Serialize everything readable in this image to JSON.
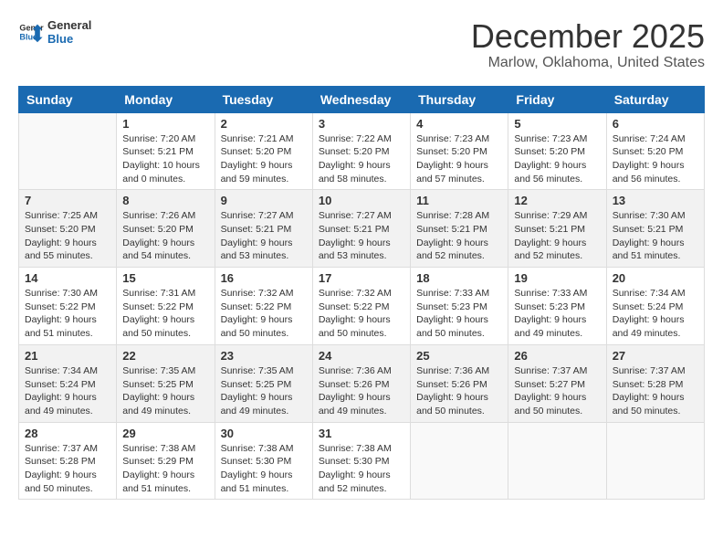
{
  "logo": {
    "line1": "General",
    "line2": "Blue"
  },
  "title": "December 2025",
  "subtitle": "Marlow, Oklahoma, United States",
  "weekdays": [
    "Sunday",
    "Monday",
    "Tuesday",
    "Wednesday",
    "Thursday",
    "Friday",
    "Saturday"
  ],
  "weeks": [
    [
      {
        "day": "",
        "detail": ""
      },
      {
        "day": "1",
        "detail": "Sunrise: 7:20 AM\nSunset: 5:21 PM\nDaylight: 10 hours\nand 0 minutes."
      },
      {
        "day": "2",
        "detail": "Sunrise: 7:21 AM\nSunset: 5:20 PM\nDaylight: 9 hours\nand 59 minutes."
      },
      {
        "day": "3",
        "detail": "Sunrise: 7:22 AM\nSunset: 5:20 PM\nDaylight: 9 hours\nand 58 minutes."
      },
      {
        "day": "4",
        "detail": "Sunrise: 7:23 AM\nSunset: 5:20 PM\nDaylight: 9 hours\nand 57 minutes."
      },
      {
        "day": "5",
        "detail": "Sunrise: 7:23 AM\nSunset: 5:20 PM\nDaylight: 9 hours\nand 56 minutes."
      },
      {
        "day": "6",
        "detail": "Sunrise: 7:24 AM\nSunset: 5:20 PM\nDaylight: 9 hours\nand 56 minutes."
      }
    ],
    [
      {
        "day": "7",
        "detail": "Sunrise: 7:25 AM\nSunset: 5:20 PM\nDaylight: 9 hours\nand 55 minutes."
      },
      {
        "day": "8",
        "detail": "Sunrise: 7:26 AM\nSunset: 5:20 PM\nDaylight: 9 hours\nand 54 minutes."
      },
      {
        "day": "9",
        "detail": "Sunrise: 7:27 AM\nSunset: 5:21 PM\nDaylight: 9 hours\nand 53 minutes."
      },
      {
        "day": "10",
        "detail": "Sunrise: 7:27 AM\nSunset: 5:21 PM\nDaylight: 9 hours\nand 53 minutes."
      },
      {
        "day": "11",
        "detail": "Sunrise: 7:28 AM\nSunset: 5:21 PM\nDaylight: 9 hours\nand 52 minutes."
      },
      {
        "day": "12",
        "detail": "Sunrise: 7:29 AM\nSunset: 5:21 PM\nDaylight: 9 hours\nand 52 minutes."
      },
      {
        "day": "13",
        "detail": "Sunrise: 7:30 AM\nSunset: 5:21 PM\nDaylight: 9 hours\nand 51 minutes."
      }
    ],
    [
      {
        "day": "14",
        "detail": "Sunrise: 7:30 AM\nSunset: 5:22 PM\nDaylight: 9 hours\nand 51 minutes."
      },
      {
        "day": "15",
        "detail": "Sunrise: 7:31 AM\nSunset: 5:22 PM\nDaylight: 9 hours\nand 50 minutes."
      },
      {
        "day": "16",
        "detail": "Sunrise: 7:32 AM\nSunset: 5:22 PM\nDaylight: 9 hours\nand 50 minutes."
      },
      {
        "day": "17",
        "detail": "Sunrise: 7:32 AM\nSunset: 5:22 PM\nDaylight: 9 hours\nand 50 minutes."
      },
      {
        "day": "18",
        "detail": "Sunrise: 7:33 AM\nSunset: 5:23 PM\nDaylight: 9 hours\nand 50 minutes."
      },
      {
        "day": "19",
        "detail": "Sunrise: 7:33 AM\nSunset: 5:23 PM\nDaylight: 9 hours\nand 49 minutes."
      },
      {
        "day": "20",
        "detail": "Sunrise: 7:34 AM\nSunset: 5:24 PM\nDaylight: 9 hours\nand 49 minutes."
      }
    ],
    [
      {
        "day": "21",
        "detail": "Sunrise: 7:34 AM\nSunset: 5:24 PM\nDaylight: 9 hours\nand 49 minutes."
      },
      {
        "day": "22",
        "detail": "Sunrise: 7:35 AM\nSunset: 5:25 PM\nDaylight: 9 hours\nand 49 minutes."
      },
      {
        "day": "23",
        "detail": "Sunrise: 7:35 AM\nSunset: 5:25 PM\nDaylight: 9 hours\nand 49 minutes."
      },
      {
        "day": "24",
        "detail": "Sunrise: 7:36 AM\nSunset: 5:26 PM\nDaylight: 9 hours\nand 49 minutes."
      },
      {
        "day": "25",
        "detail": "Sunrise: 7:36 AM\nSunset: 5:26 PM\nDaylight: 9 hours\nand 50 minutes."
      },
      {
        "day": "26",
        "detail": "Sunrise: 7:37 AM\nSunset: 5:27 PM\nDaylight: 9 hours\nand 50 minutes."
      },
      {
        "day": "27",
        "detail": "Sunrise: 7:37 AM\nSunset: 5:28 PM\nDaylight: 9 hours\nand 50 minutes."
      }
    ],
    [
      {
        "day": "28",
        "detail": "Sunrise: 7:37 AM\nSunset: 5:28 PM\nDaylight: 9 hours\nand 50 minutes."
      },
      {
        "day": "29",
        "detail": "Sunrise: 7:38 AM\nSunset: 5:29 PM\nDaylight: 9 hours\nand 51 minutes."
      },
      {
        "day": "30",
        "detail": "Sunrise: 7:38 AM\nSunset: 5:30 PM\nDaylight: 9 hours\nand 51 minutes."
      },
      {
        "day": "31",
        "detail": "Sunrise: 7:38 AM\nSunset: 5:30 PM\nDaylight: 9 hours\nand 52 minutes."
      },
      {
        "day": "",
        "detail": ""
      },
      {
        "day": "",
        "detail": ""
      },
      {
        "day": "",
        "detail": ""
      }
    ]
  ]
}
